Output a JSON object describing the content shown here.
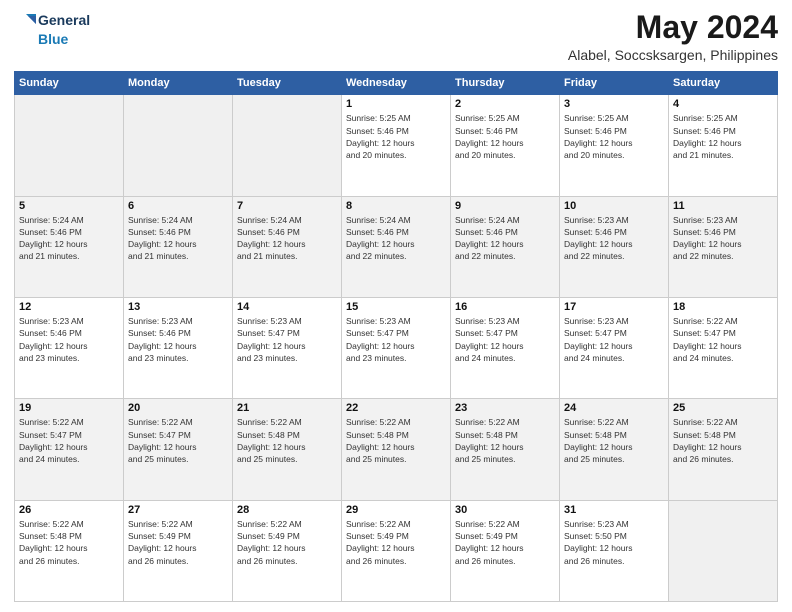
{
  "logo": {
    "line1": "General",
    "line2": "Blue"
  },
  "title": "May 2024",
  "location": "Alabel, Soccsksargen, Philippines",
  "days_of_week": [
    "Sunday",
    "Monday",
    "Tuesday",
    "Wednesday",
    "Thursday",
    "Friday",
    "Saturday"
  ],
  "weeks": [
    [
      {
        "day": "",
        "info": ""
      },
      {
        "day": "",
        "info": ""
      },
      {
        "day": "",
        "info": ""
      },
      {
        "day": "1",
        "info": "Sunrise: 5:25 AM\nSunset: 5:46 PM\nDaylight: 12 hours\nand 20 minutes."
      },
      {
        "day": "2",
        "info": "Sunrise: 5:25 AM\nSunset: 5:46 PM\nDaylight: 12 hours\nand 20 minutes."
      },
      {
        "day": "3",
        "info": "Sunrise: 5:25 AM\nSunset: 5:46 PM\nDaylight: 12 hours\nand 20 minutes."
      },
      {
        "day": "4",
        "info": "Sunrise: 5:25 AM\nSunset: 5:46 PM\nDaylight: 12 hours\nand 21 minutes."
      }
    ],
    [
      {
        "day": "5",
        "info": "Sunrise: 5:24 AM\nSunset: 5:46 PM\nDaylight: 12 hours\nand 21 minutes."
      },
      {
        "day": "6",
        "info": "Sunrise: 5:24 AM\nSunset: 5:46 PM\nDaylight: 12 hours\nand 21 minutes."
      },
      {
        "day": "7",
        "info": "Sunrise: 5:24 AM\nSunset: 5:46 PM\nDaylight: 12 hours\nand 21 minutes."
      },
      {
        "day": "8",
        "info": "Sunrise: 5:24 AM\nSunset: 5:46 PM\nDaylight: 12 hours\nand 22 minutes."
      },
      {
        "day": "9",
        "info": "Sunrise: 5:24 AM\nSunset: 5:46 PM\nDaylight: 12 hours\nand 22 minutes."
      },
      {
        "day": "10",
        "info": "Sunrise: 5:23 AM\nSunset: 5:46 PM\nDaylight: 12 hours\nand 22 minutes."
      },
      {
        "day": "11",
        "info": "Sunrise: 5:23 AM\nSunset: 5:46 PM\nDaylight: 12 hours\nand 22 minutes."
      }
    ],
    [
      {
        "day": "12",
        "info": "Sunrise: 5:23 AM\nSunset: 5:46 PM\nDaylight: 12 hours\nand 23 minutes."
      },
      {
        "day": "13",
        "info": "Sunrise: 5:23 AM\nSunset: 5:46 PM\nDaylight: 12 hours\nand 23 minutes."
      },
      {
        "day": "14",
        "info": "Sunrise: 5:23 AM\nSunset: 5:47 PM\nDaylight: 12 hours\nand 23 minutes."
      },
      {
        "day": "15",
        "info": "Sunrise: 5:23 AM\nSunset: 5:47 PM\nDaylight: 12 hours\nand 23 minutes."
      },
      {
        "day": "16",
        "info": "Sunrise: 5:23 AM\nSunset: 5:47 PM\nDaylight: 12 hours\nand 24 minutes."
      },
      {
        "day": "17",
        "info": "Sunrise: 5:23 AM\nSunset: 5:47 PM\nDaylight: 12 hours\nand 24 minutes."
      },
      {
        "day": "18",
        "info": "Sunrise: 5:22 AM\nSunset: 5:47 PM\nDaylight: 12 hours\nand 24 minutes."
      }
    ],
    [
      {
        "day": "19",
        "info": "Sunrise: 5:22 AM\nSunset: 5:47 PM\nDaylight: 12 hours\nand 24 minutes."
      },
      {
        "day": "20",
        "info": "Sunrise: 5:22 AM\nSunset: 5:47 PM\nDaylight: 12 hours\nand 25 minutes."
      },
      {
        "day": "21",
        "info": "Sunrise: 5:22 AM\nSunset: 5:48 PM\nDaylight: 12 hours\nand 25 minutes."
      },
      {
        "day": "22",
        "info": "Sunrise: 5:22 AM\nSunset: 5:48 PM\nDaylight: 12 hours\nand 25 minutes."
      },
      {
        "day": "23",
        "info": "Sunrise: 5:22 AM\nSunset: 5:48 PM\nDaylight: 12 hours\nand 25 minutes."
      },
      {
        "day": "24",
        "info": "Sunrise: 5:22 AM\nSunset: 5:48 PM\nDaylight: 12 hours\nand 25 minutes."
      },
      {
        "day": "25",
        "info": "Sunrise: 5:22 AM\nSunset: 5:48 PM\nDaylight: 12 hours\nand 26 minutes."
      }
    ],
    [
      {
        "day": "26",
        "info": "Sunrise: 5:22 AM\nSunset: 5:48 PM\nDaylight: 12 hours\nand 26 minutes."
      },
      {
        "day": "27",
        "info": "Sunrise: 5:22 AM\nSunset: 5:49 PM\nDaylight: 12 hours\nand 26 minutes."
      },
      {
        "day": "28",
        "info": "Sunrise: 5:22 AM\nSunset: 5:49 PM\nDaylight: 12 hours\nand 26 minutes."
      },
      {
        "day": "29",
        "info": "Sunrise: 5:22 AM\nSunset: 5:49 PM\nDaylight: 12 hours\nand 26 minutes."
      },
      {
        "day": "30",
        "info": "Sunrise: 5:22 AM\nSunset: 5:49 PM\nDaylight: 12 hours\nand 26 minutes."
      },
      {
        "day": "31",
        "info": "Sunrise: 5:23 AM\nSunset: 5:50 PM\nDaylight: 12 hours\nand 26 minutes."
      },
      {
        "day": "",
        "info": ""
      }
    ]
  ]
}
